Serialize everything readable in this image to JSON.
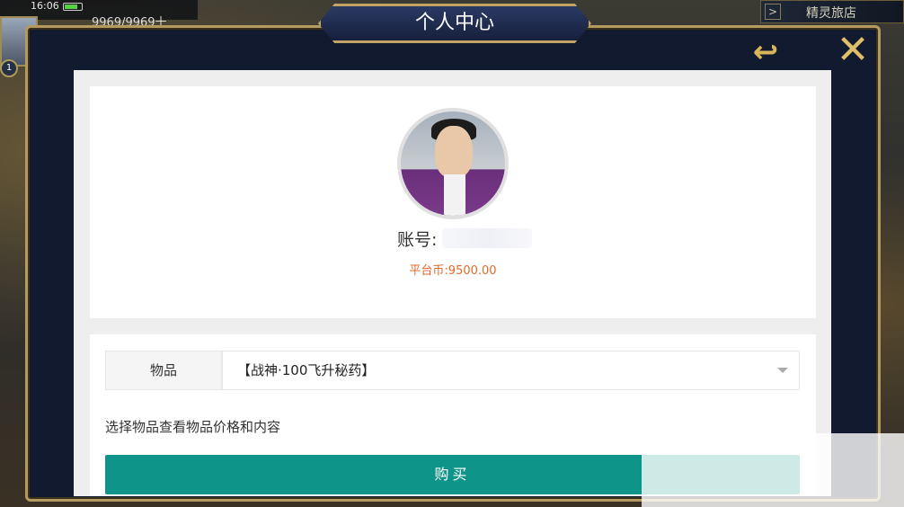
{
  "hud": {
    "time": "16:06",
    "hp": "9969/9969十",
    "level": "1",
    "right_button_label": "精灵旅店",
    "right_arrow": ">"
  },
  "panel": {
    "title": "个人中心",
    "back_icon": "back-arrow-icon",
    "close_icon": "close-icon",
    "back_glyph": "↩",
    "close_glyph": "✕"
  },
  "profile": {
    "account_label": "账号:",
    "account_value": "",
    "coins": "平台币:9500.00"
  },
  "form": {
    "item_label": "物品",
    "item_selected": "【战神·100飞升秘药】",
    "hint": "选择物品查看物品价格和内容",
    "buy_label": "购买"
  },
  "colors": {
    "accent": "#0e9488",
    "coins": "#e06a2a",
    "frame_gold": "#b59a60",
    "panel_bg": "#121a30"
  }
}
